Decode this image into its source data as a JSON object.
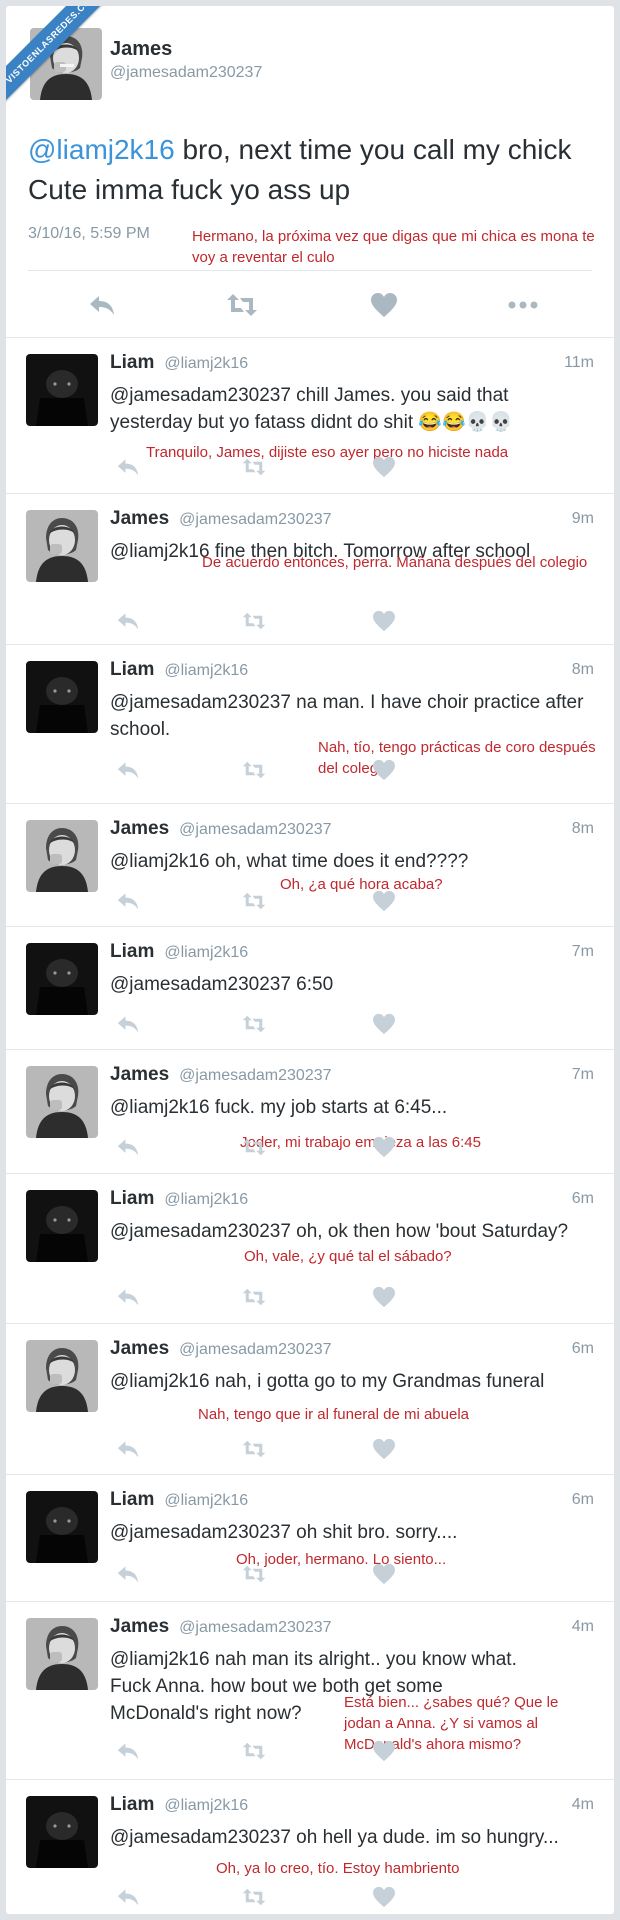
{
  "watermark": "VISTOENLASREDES.COM",
  "main_tweet": {
    "author_name": "James",
    "author_handle": "@jamesadam230237",
    "mention": "@liamj2k16",
    "text": " bro, next time you call my chick Cute imma fuck yo ass up",
    "date": "3/10/16, 5:59 PM",
    "translation": "Hermano, la próxima vez que digas que mi chica es mona te voy a reventar el culo"
  },
  "icons": {
    "reply": "reply-icon",
    "retweet": "retweet-icon",
    "like": "heart-icon",
    "more": "more-icon"
  },
  "replies": [
    {
      "name": "Liam",
      "handle": "@liamj2k16",
      "time": "11m",
      "text": "@jamesadam230237 chill James. you said that yesterday but yo fatass didnt do shit 😂😂💀💀",
      "translation": "Tranquilo, James, dijiste eso ayer pero no hiciste nada"
    },
    {
      "name": "James",
      "handle": "@jamesadam230237",
      "time": "9m",
      "text": "@liamj2k16 fine then bitch. Tomorrow after school",
      "translation": "De acuerdo entonces, perra. Mañana después del colegio"
    },
    {
      "name": "Liam",
      "handle": "@liamj2k16",
      "time": "8m",
      "text": "@jamesadam230237 na man. I have choir practice after school.",
      "translation": "Nah, tío, tengo prácticas de coro después del colegio"
    },
    {
      "name": "James",
      "handle": "@jamesadam230237",
      "time": "8m",
      "text": "@liamj2k16 oh, what time does it end????",
      "translation": "Oh, ¿a qué hora acaba?"
    },
    {
      "name": "Liam",
      "handle": "@liamj2k16",
      "time": "7m",
      "text": "@jamesadam230237 6:50",
      "translation": ""
    },
    {
      "name": "James",
      "handle": "@jamesadam230237",
      "time": "7m",
      "text": "@liamj2k16 fuck. my job starts at 6:45...",
      "translation": "Joder, mi trabajo empieza a las 6:45"
    },
    {
      "name": "Liam",
      "handle": "@liamj2k16",
      "time": "6m",
      "text": "@jamesadam230237 oh, ok then how 'bout Saturday?",
      "translation": "Oh, vale, ¿y qué tal el sábado?"
    },
    {
      "name": "James",
      "handle": "@jamesadam230237",
      "time": "6m",
      "text": "@liamj2k16 nah, i gotta go to my Grandmas funeral",
      "translation": "Nah, tengo que ir al funeral de mi abuela"
    },
    {
      "name": "Liam",
      "handle": "@liamj2k16",
      "time": "6m",
      "text": "@jamesadam230237 oh shit bro. sorry....",
      "translation": "Oh, joder, hermano. Lo siento..."
    },
    {
      "name": "James",
      "handle": "@jamesadam230237",
      "time": "4m",
      "text": "@liamj2k16 nah man its alright.. you know what. Fuck Anna. how bout we both get some McDonald's right now?",
      "translation": "Está bien... ¿sabes qué? Que le jodan a Anna. ¿Y si vamos al McDonald's ahora mismo?"
    },
    {
      "name": "Liam",
      "handle": "@liamj2k16",
      "time": "4m",
      "text": "@jamesadam230237 oh hell ya dude. im so hungry...",
      "translation": "Oh, ya lo creo, tío. Estoy hambriento"
    }
  ]
}
